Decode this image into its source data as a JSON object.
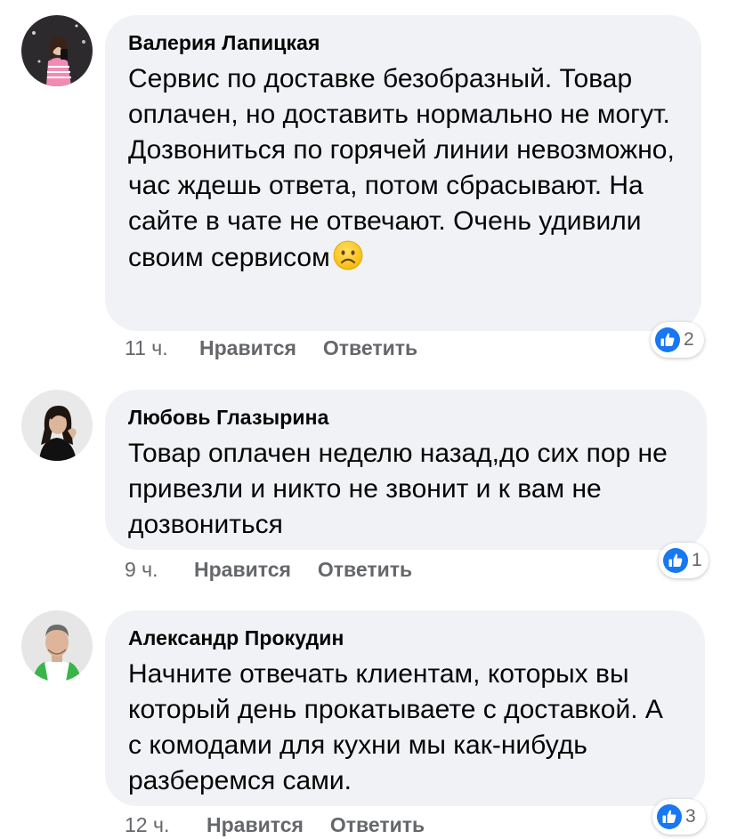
{
  "comments": [
    {
      "author": "Валерия Лапицкая",
      "text": "Сервис по доставке безобразный. Товар оплачен, но доставить нормально не могут. Дозвониться по горячей линии невозможно, час ждешь ответа, потом сбрасывают. На сайте в чате не отвечают. Очень удивили своим сервисом",
      "emoji": "frowning-face-emoji",
      "time": "11 ч.",
      "like_label": "Нравится",
      "reply_label": "Ответить",
      "reaction_count": "2",
      "reaction_icon": "like-icon"
    },
    {
      "author": "Любовь Глазырина",
      "text": "Товар оплачен неделю назад,до сих пор не привезли и никто не звонит и к вам не дозвониться",
      "time": "9 ч.",
      "like_label": "Нравится",
      "reply_label": "Ответить",
      "reaction_count": "1",
      "reaction_icon": "like-icon"
    },
    {
      "author": "Александр Прокудин",
      "text": "Начните отвечать клиентам, которых вы который день прокатываете с доставкой. А с комодами для кухни мы как-нибудь разберемся сами.",
      "time": "12 ч.",
      "like_label": "Нравится",
      "reply_label": "Ответить",
      "reaction_count": "3",
      "reaction_icon": "like-icon"
    }
  ],
  "colors": {
    "bubble": "#f0f2f5",
    "meta_text": "#65676b",
    "like_blue": "#1877f2"
  }
}
